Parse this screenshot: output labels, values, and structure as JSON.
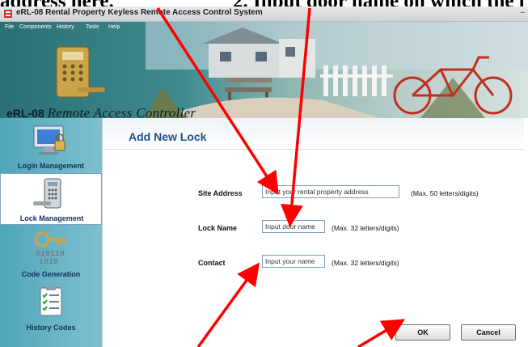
{
  "annotation": {
    "left_text": "address here.",
    "right_text": "2. Input door name on which the l"
  },
  "window": {
    "title": "eRL-08 Rental Property Keyless Remote Access Control System",
    "controls": "–"
  },
  "menu": [
    "File",
    "Components",
    "History",
    "Tools",
    "Help"
  ],
  "banner": {
    "logo_prefix": "eRL-08",
    "logo_script": "Remote Access Controller"
  },
  "sidebar": {
    "items": [
      {
        "label": "Login Management",
        "icon": "monitor-lock-icon",
        "active": false
      },
      {
        "label": "Lock Management",
        "icon": "keypad-lock-icon",
        "active": true
      },
      {
        "label": "Code Generation",
        "icon": "binary-key-icon",
        "active": false
      },
      {
        "label": "History Codes",
        "icon": "checklist-icon",
        "active": false
      }
    ]
  },
  "content": {
    "title": "Add New Lock",
    "fields": [
      {
        "label": "Site Address",
        "placeholder": "Input your rental property address",
        "hint": "(Max. 50 letters/digits)"
      },
      {
        "label": "Lock Name",
        "placeholder": "Input door name",
        "hint": "(Max. 32 letters/digits)"
      },
      {
        "label": "Contact",
        "placeholder": "Input your name",
        "hint": "(Max. 32 letters/digits)"
      }
    ],
    "ok_label": "OK",
    "cancel_label": "Cancel"
  },
  "colors": {
    "arrow": "#ff0000",
    "title_blue": "#1f4e8a",
    "sidebar_teal": "#4fa5b9"
  }
}
